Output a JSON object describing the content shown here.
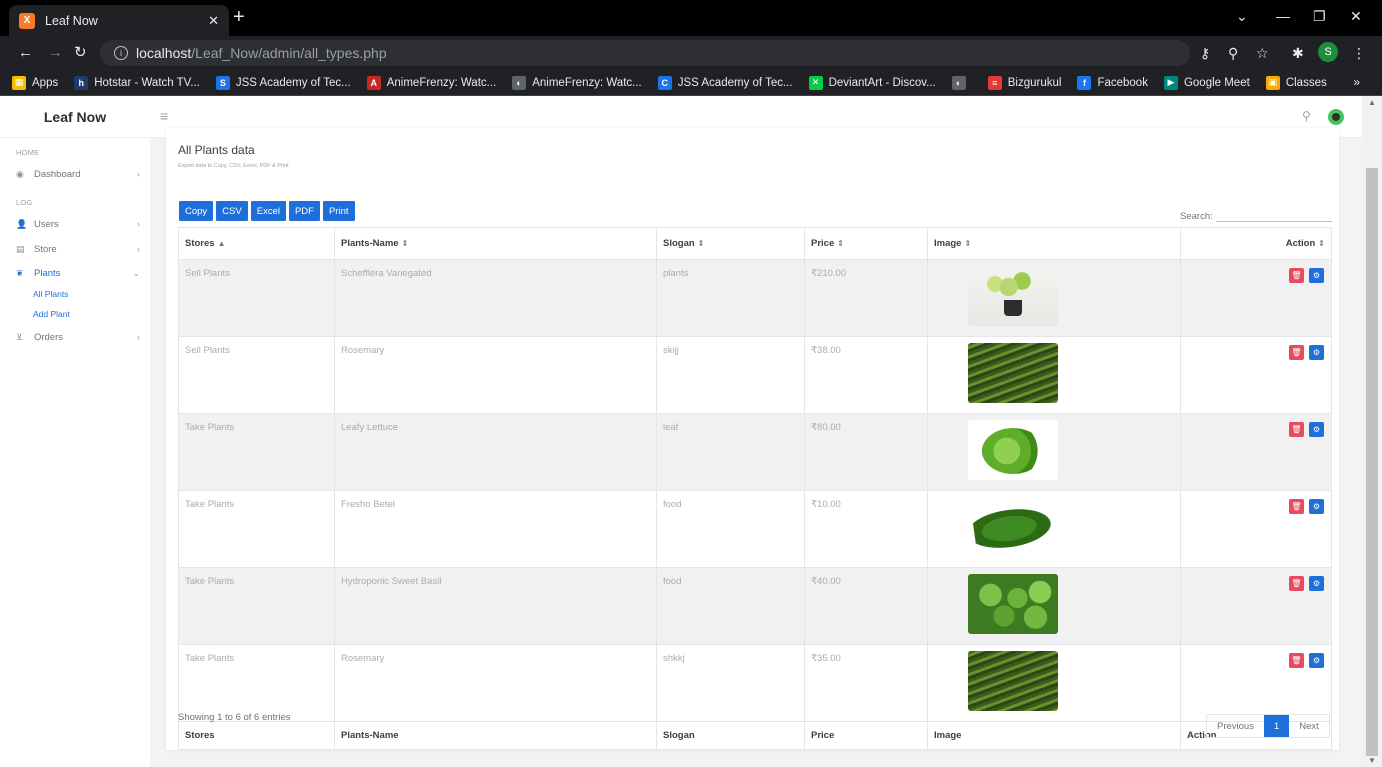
{
  "browser": {
    "tab_title": "Leaf Now",
    "tab_favicon_letter": "X",
    "url_host": "localhost",
    "url_path": "/Leaf_Now/admin/all_types.php",
    "profile_initial": "S",
    "bookmarks": [
      {
        "label": "Apps",
        "color": "#fbbc04",
        "glyph": "▦"
      },
      {
        "label": "Hotstar - Watch TV...",
        "color": "#1f3a6b",
        "glyph": "h"
      },
      {
        "label": "JSS Academy of Tec...",
        "color": "#1a73e8",
        "glyph": "S"
      },
      {
        "label": "AnimeFrenzy: Watc...",
        "color": "#c62828",
        "glyph": "A"
      },
      {
        "label": "AnimeFrenzy: Watc...",
        "color": "#5f6368",
        "glyph": "◐"
      },
      {
        "label": "JSS Academy of Tec...",
        "color": "#1a73e8",
        "glyph": "C"
      },
      {
        "label": "DeviantArt - Discov...",
        "color": "#05cc47",
        "glyph": "✕"
      },
      {
        "label": "",
        "color": "#5f6368",
        "glyph": "◐"
      },
      {
        "label": "Bizgurukul",
        "color": "#e53935",
        "glyph": "≡"
      },
      {
        "label": "Facebook",
        "color": "#1877f2",
        "glyph": "f"
      },
      {
        "label": "Google Meet",
        "color": "#00897b",
        "glyph": "▶"
      },
      {
        "label": "Classes",
        "color": "#f9ab00",
        "glyph": "▣"
      }
    ]
  },
  "app": {
    "brand": "Leaf Now"
  },
  "sidebar": {
    "section_home": "HOME",
    "section_log": "LOG",
    "dashboard": "Dashboard",
    "users": "Users",
    "store": "Store",
    "plants": "Plants",
    "all_plants": "All Plants",
    "add_plant": "Add Plant",
    "orders": "Orders"
  },
  "main": {
    "title": "All Plants data",
    "subtitle": "Export data to Copy, CSV, Excel, PDF & Print",
    "buttons": {
      "copy": "Copy",
      "csv": "CSV",
      "excel": "Excel",
      "pdf": "PDF",
      "print": "Print"
    },
    "search_label": "Search:",
    "columns": {
      "stores": "Stores",
      "plants_name": "Plants-Name",
      "slogan": "Slogan",
      "price": "Price",
      "image": "Image",
      "action": "Action"
    },
    "rows": [
      {
        "store": "Sell Plants",
        "name": "Schefflera Variegated",
        "slogan": "plants",
        "price": "₹210.00",
        "image": "plant-1"
      },
      {
        "store": "Sell Plants",
        "name": "Rosemary",
        "slogan": "skijj",
        "price": "₹38.00",
        "image": "plant-2"
      },
      {
        "store": "Take Plants",
        "name": "Leafy Lettuce",
        "slogan": "leaf",
        "price": "₹80.00",
        "image": "plant-3"
      },
      {
        "store": "Take Plants",
        "name": "Fresho Betel",
        "slogan": "food",
        "price": "₹10.00",
        "image": "plant-4"
      },
      {
        "store": "Take Plants",
        "name": "Hydroponic Sweet Basil",
        "slogan": "food",
        "price": "₹40.00",
        "image": "plant-5"
      },
      {
        "store": "Take Plants",
        "name": "Rosemary",
        "slogan": "shkkj",
        "price": "₹35.00",
        "image": "plant-2"
      }
    ],
    "info": "Showing 1 to 6 of 6 entries",
    "pager": {
      "previous": "Previous",
      "current": "1",
      "next": "Next"
    }
  },
  "colors": {
    "primary": "#1e6fd9",
    "danger": "#e84a5f",
    "row_stripe": "#f1f1f1"
  }
}
